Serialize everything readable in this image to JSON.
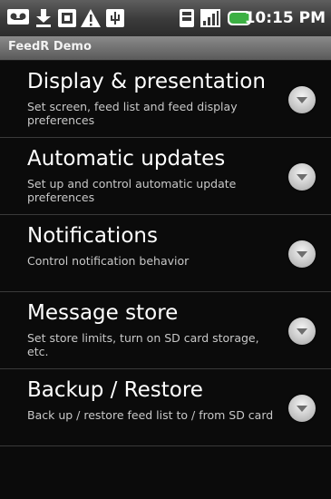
{
  "status_bar": {
    "time": "10:15 PM",
    "icons": [
      "voicemail-icon",
      "download-icon",
      "sd-card-icon",
      "warning-icon",
      "usb-icon",
      "sim-card-icon",
      "signal-icon",
      "battery-icon"
    ],
    "battery_color": "#3cb043"
  },
  "app": {
    "title": "FeedR Demo"
  },
  "preferences": [
    {
      "title": "Display & presentation",
      "summary": "Set screen, feed list and feed display preferences"
    },
    {
      "title": "Automatic updates",
      "summary": "Set up and control automatic update preferences"
    },
    {
      "title": "Notifications",
      "summary": "Control notification behavior"
    },
    {
      "title": "Message store",
      "summary": "Set store limits, turn on SD card storage, etc."
    },
    {
      "title": "Backup / Restore",
      "summary": "Back up / restore feed list to / from SD card"
    }
  ]
}
